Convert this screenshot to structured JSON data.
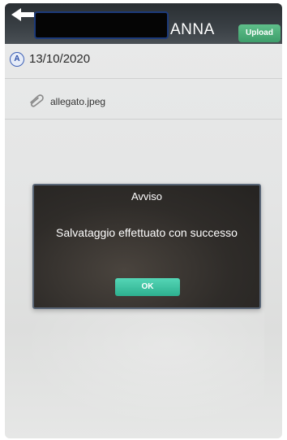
{
  "header": {
    "name": "ANNA",
    "upload_label": "Upload"
  },
  "message_row": {
    "avatar_letter": "A",
    "date": "13/10/2020"
  },
  "attachment": {
    "filename": "allegato.jpeg"
  },
  "dialog": {
    "title": "Avviso",
    "message": "Salvataggio effettuato con successo",
    "ok_label": "OK"
  },
  "colors": {
    "header_bg": "#2a2f33",
    "upload_green": "#4caf7d",
    "ok_teal": "#3cc4a2",
    "dialog_bg": "#2f2c29",
    "avatar_blue": "#3b5fb6"
  }
}
